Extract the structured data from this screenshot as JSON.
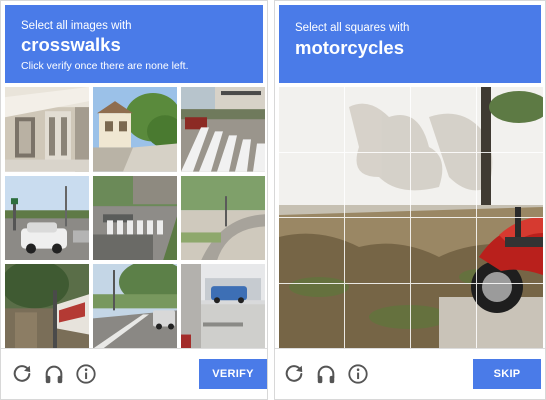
{
  "left": {
    "instruction": "Select all images with",
    "target": "crosswalks",
    "note": "Click verify once there are none left.",
    "button": "VERIFY"
  },
  "right": {
    "instruction": "Select all squares with",
    "target": "motorcycles",
    "button": "SKIP"
  },
  "icons": [
    "reload-icon",
    "headphones-icon",
    "info-icon"
  ],
  "colors": {
    "accent": "#4a7be8",
    "icon": "#555555"
  }
}
